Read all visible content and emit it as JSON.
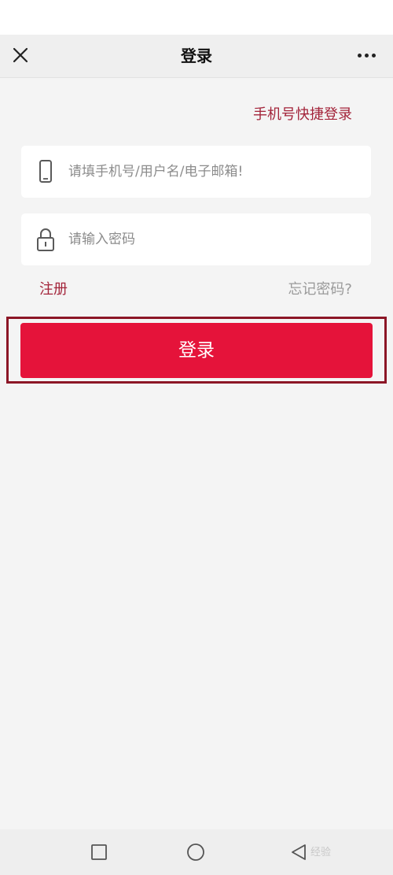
{
  "header": {
    "title": "登录"
  },
  "quick_login_label": "手机号快捷登录",
  "form": {
    "account_placeholder": "请填手机号/用户名/电子邮箱!",
    "account_value": "",
    "password_placeholder": "请输入密码",
    "password_value": "",
    "register_label": "注册",
    "forgot_label": "忘记密码?",
    "submit_label": "登录"
  },
  "watermark_text": "经验",
  "colors": {
    "accent": "#e5133a",
    "link": "#a3243a",
    "highlight_border": "#8c1626"
  },
  "icons": {
    "close": "close-icon",
    "more": "more-icon",
    "phone": "phone-icon",
    "lock": "lock-icon",
    "recent": "square-icon",
    "home": "circle-icon",
    "back": "triangle-back-icon"
  }
}
